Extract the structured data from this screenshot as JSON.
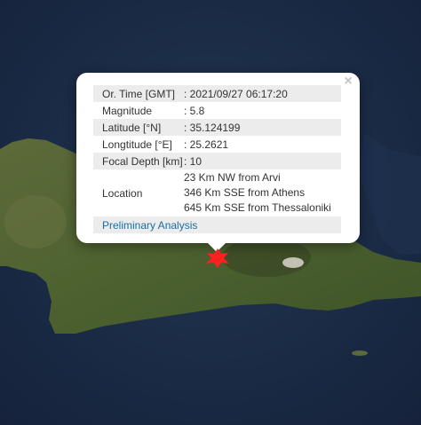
{
  "popup": {
    "close_glyph": "×",
    "rows": [
      {
        "label": "Or. Time [GMT]",
        "value": ": 2021/09/27 06:17:20"
      },
      {
        "label": "Magnitude",
        "value": ": 5.8"
      },
      {
        "label": "Latitude [°N]",
        "value": ": 35.124199"
      },
      {
        "label": "Longtitude [°E]",
        "value": ": 25.2621"
      },
      {
        "label": "Focal Depth [km]",
        "value": ": 10"
      }
    ],
    "location": {
      "label": "Location",
      "lines": [
        "23 Km NW from Arvi",
        "346 Km SSE from Athens",
        "645 Km SSE from Thessaloniki"
      ]
    },
    "link_label": "Preliminary Analysis"
  },
  "marker": {
    "icon": "earthquake-marker-icon",
    "color": "#ff2020"
  },
  "colors": {
    "sea": "#1b2a3e",
    "land": "#4b5e2e",
    "link": "#1a6ea8"
  }
}
